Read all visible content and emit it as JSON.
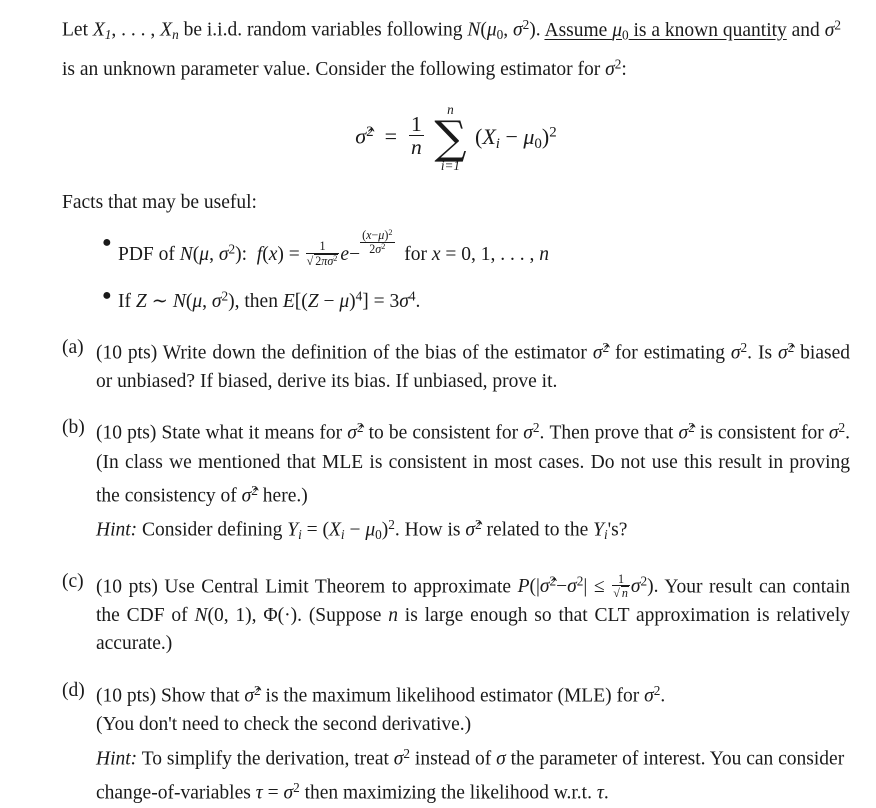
{
  "document": {
    "type": "statistics-homework-problem",
    "intro": {
      "line1_prefix": "Let ",
      "random_vars": "X₁, … , Xₙ",
      "line1_mid": " be i.i.d. random variables following ",
      "distribution": "N(μ₀, σ²)",
      "line1_period": ". ",
      "underlined_text": "Assume μ₀ is a known quantity",
      "line2": "and σ² is an unknown parameter value. Consider the following estimator for σ²:",
      "full_text": "Let X₁, … , Xₙ be i.i.d. random variables following N(μ₀, σ²). Assume μ₀ is a known quantity and σ² is an unknown parameter value. Consider the following estimator for σ²:"
    },
    "display_equation": {
      "latex": "\\hat{\\sigma}^2 = \\frac{1}{n}\\sum_{i=1}^{n}(X_i-\\mu_0)^2",
      "plain": "σ̂² = (1/n) Σ_{i=1}^{n} (Xᵢ − μ₀)²",
      "lhs": "σ̂",
      "lhs_exp": "2",
      "relation": "=",
      "frac_num": "1",
      "frac_den": "n",
      "sum_upper": "n",
      "sum_lower": "i=1",
      "summand": "(Xᵢ − μ₀)²"
    },
    "facts_heading": "Facts that may be useful:",
    "facts": [
      {
        "bullet": "•",
        "label": "pdf-fact",
        "plain": "PDF of N(μ, σ²):  f(x) = 1/√(2πσ²) e^{−(x−μ)²/(2σ²)}  for x = 0, 1, … , n",
        "prefix": "PDF of ",
        "dist": "N(μ, σ²)",
        "colon": ": ",
        "fx": "f(x)",
        "equals": "=",
        "frac_num": "1",
        "sqrt_radicand": "2πσ²",
        "e": "e",
        "exp_sign": "−",
        "exp_num": "(x−μ)²",
        "exp_den": "2σ²",
        "suffix": " for x = 0, 1, … , n"
      },
      {
        "bullet": "•",
        "label": "fourth-moment-fact",
        "plain": "If Z ~ N(μ, σ²), then E[(Z − μ)⁴] = 3σ⁴.",
        "prefix": "If ",
        "z": "Z",
        "tilde": " ∼ ",
        "dist": "N(μ, σ²)",
        "mid": ", then ",
        "expectation": "E[(Z − μ)⁴] = 3σ⁴."
      }
    ],
    "parts": [
      {
        "marker": "(a)",
        "points": "(10 pts)",
        "text": "Write down the definition of the bias of the estimator σ̂² for estimating σ². Is σ̂² biased or unbiased? If biased, derive its bias. If unbiased, prove it.",
        "line1": "Write down the definition of the bias of the estimator σ̂² for estimating σ². Is",
        "line2": "σ̂² biased or unbiased? If biased, derive its bias. If unbiased, prove it.",
        "hint": null
      },
      {
        "marker": "(b)",
        "points": "(10 pts)",
        "text": "State what it means for σ̂² to be consistent for σ². Then prove that σ̂² is consistent for σ². (In class we mentioned that MLE is consistent in most cases. Do not use this result in proving the consistency of σ̂² here.)",
        "line1": "State what it means for σ̂² to be consistent for σ². Then prove that σ̂² is",
        "line2": "consistent for σ². (In class we mentioned that MLE is consistent in most cases. Do not",
        "line3": "use this result in proving the consistency of σ̂² here.)",
        "hint": {
          "label": "Hint:",
          "text": "Consider defining Yᵢ = (Xᵢ − μ₀)². How is σ̂² related to the Yᵢ's?"
        }
      },
      {
        "marker": "(c)",
        "points": "(10 pts)",
        "text": "Use Central Limit Theorem to approximate P(|σ̂²−σ²| ≤ (1/√n)σ²). Your result can contain the CDF of N(0, 1), Φ(·). (Suppose n is large enough so that CLT approximation is relatively accurate.)",
        "line1_a": "Use Central Limit Theorem to approximate ",
        "prob_open": "P(|σ̂",
        "prob_mid": "−σ",
        "prob_le": "| ≤ ",
        "prob_frac_num": "1",
        "prob_frac_den": "√n",
        "prob_tail": "σ²).",
        "line1_b": " Your result can",
        "line2": "contain the CDF of N(0, 1), Φ(·). (Suppose n is large enough so that CLT approximation",
        "line3": "is relatively accurate.)",
        "hint": null
      },
      {
        "marker": "(d)",
        "points": "(10 pts)",
        "text": "Show that σ̂² is the maximum likelihood estimator (MLE) for σ². (You don't need to check the second derivative.)",
        "line1": "Show that σ̂² is the maximum likelihood estimator (MLE) for σ².",
        "line2": "(You don't need to check the second derivative.)",
        "hint": {
          "label": "Hint:",
          "text": "To simplify the derivation, treat σ² instead of σ the parameter of interest. You can consider change-of-variables τ = σ² then maximizing the likelihood w.r.t. τ.",
          "line1": "To simplify the derivation, treat σ² instead of σ the parameter of interest. You",
          "line2": "can consider change-of-variables τ = σ² then maximizing the likelihood w.r.t. τ."
        }
      }
    ],
    "colors": {
      "background": "#ffffff",
      "text": "#1a1a1a"
    }
  }
}
